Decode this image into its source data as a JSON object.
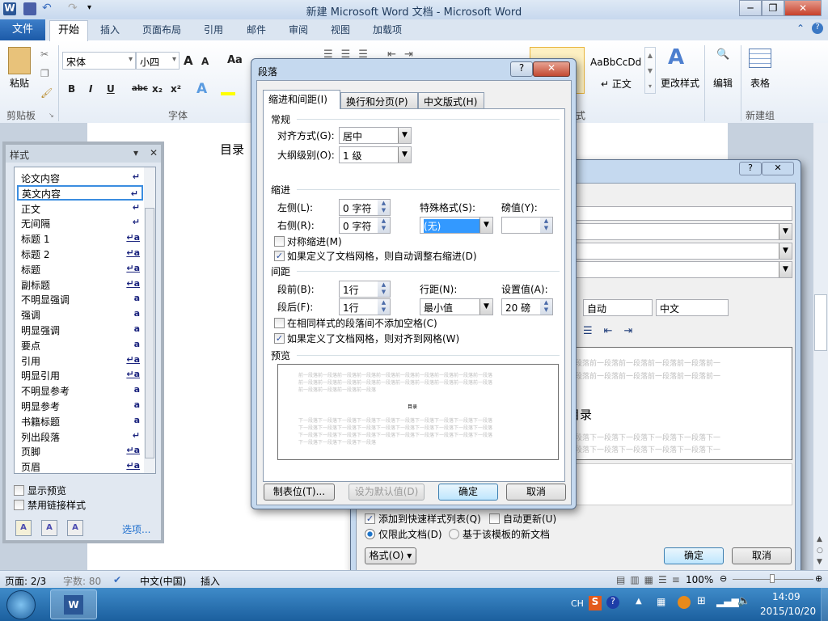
{
  "window": {
    "title": "新建 Microsoft Word 文档 - Microsoft Word",
    "min": "─",
    "max": "❐",
    "close": "✕"
  },
  "ribbon": {
    "file_tab": "文件",
    "tabs": [
      "开始",
      "插入",
      "页面布局",
      "引用",
      "邮件",
      "审阅",
      "视图",
      "加载项"
    ],
    "help": "?",
    "paste": "粘贴",
    "clipboard_group": "剪贴板",
    "font_group": "字体",
    "font_name": "宋体",
    "font_size": "小四",
    "grow": "A",
    "shrink": "A",
    "case": "Aa",
    "bold": "B",
    "italic": "I",
    "underline": "U",
    "strike": "abc",
    "sub": "x₂",
    "sup": "x²",
    "style_sample": "AaBbCcDd",
    "style_normal": "↵ 正文",
    "change_styles": "更改样式",
    "styles_group": "式",
    "editing": "编辑",
    "table": "表格",
    "newgroup": "新建组"
  },
  "document": {
    "heading": "目录"
  },
  "styles_pane": {
    "title": "样式",
    "items": [
      {
        "label": "论文内容",
        "mark": "↵"
      },
      {
        "label": "英文内容",
        "mark": "↵"
      },
      {
        "label": "正文",
        "mark": "↵"
      },
      {
        "label": "无间隔",
        "mark": "↵"
      },
      {
        "label": "标题 1",
        "mark": "↵a"
      },
      {
        "label": "标题 2",
        "mark": "↵a"
      },
      {
        "label": "标题",
        "mark": "↵a"
      },
      {
        "label": "副标题",
        "mark": "↵a"
      },
      {
        "label": "不明显强调",
        "mark": "a"
      },
      {
        "label": "强调",
        "mark": "a"
      },
      {
        "label": "明显强调",
        "mark": "a"
      },
      {
        "label": "要点",
        "mark": "a"
      },
      {
        "label": "引用",
        "mark": "↵a"
      },
      {
        "label": "明显引用",
        "mark": "↵a"
      },
      {
        "label": "不明显参考",
        "mark": "a"
      },
      {
        "label": "明显参考",
        "mark": "a"
      },
      {
        "label": "书籍标题",
        "mark": "a"
      },
      {
        "label": "列出段落",
        "mark": "↵"
      },
      {
        "label": "页脚",
        "mark": "↵a"
      },
      {
        "label": "页眉",
        "mark": "↵a"
      }
    ],
    "selected_index": 1,
    "show_preview": "显示预览",
    "disable_linked": "禁用链接样式",
    "options": "选项..."
  },
  "paragraph_dialog": {
    "title": "段落",
    "help": "?",
    "close": "✕",
    "tabs": [
      "缩进和间距(I)",
      "换行和分页(P)",
      "中文版式(H)"
    ],
    "general": "常规",
    "alignment_label": "对齐方式(G):",
    "alignment": "居中",
    "outline_label": "大纲级别(O):",
    "outline": "1 级",
    "indent": "缩进",
    "left_label": "左侧(L):",
    "left": "0 字符",
    "right_label": "右侧(R):",
    "right": "0 字符",
    "special_label": "特殊格式(S):",
    "special": "(无)",
    "by_label": "磅值(Y):",
    "by": "",
    "mirror": "对称缩进(M)",
    "mirror_checked": false,
    "auto_adjust": "如果定义了文档网格，则自动调整右缩进(D)",
    "auto_adjust_checked": true,
    "spacing": "间距",
    "before_label": "段前(B):",
    "before": "1行",
    "after_label": "段后(F):",
    "after": "1行",
    "line_label": "行距(N):",
    "line": "最小值",
    "at_label": "设置值(A):",
    "at": "20 磅",
    "no_space": "在相同样式的段落间不添加空格(C)",
    "no_space_checked": false,
    "snap": "如果定义了文档网格，则对齐到网格(W)",
    "snap_checked": true,
    "preview": "预览",
    "preview_prev": "前一段落前一段落前一段落前一段落前一段落前一段落前一段落前一段落前一段落前一段落",
    "preview_text": "目录",
    "preview_next": "下一段落下一段落下一段落下一段落下一段落下一段落下一段落下一段落下一段落下一段落",
    "tabs_btn": "制表位(T)...",
    "default_btn": "设为默认值(D)",
    "ok": "确定",
    "cancel": "取消"
  },
  "modify_dialog": {
    "help": "?",
    "close": "✕",
    "color": "自动",
    "lang": "中文",
    "preview_heading": "目录",
    "preview_prev": "一段落前一段落前一段落前一段落前一段落前一",
    "preview_next": "一段落下一段落下一段落下一段落下一段落下一",
    "add_quick": "添加到快速样式列表(Q)",
    "add_quick_checked": true,
    "auto_update": "自动更新(U)",
    "auto_update_checked": false,
    "this_doc": "仅限此文档(D)",
    "template": "基于该模板的新文档",
    "format": "格式(O) ▾",
    "ok": "确定",
    "cancel": "取消"
  },
  "statusbar": {
    "page": "页面: 2/3",
    "words": "字数: 80",
    "lang": "中文(中国)",
    "mode": "插入",
    "zoom": "100%"
  },
  "taskbar": {
    "ime": "CH",
    "time": "14:09",
    "date": "2015/10/20"
  }
}
